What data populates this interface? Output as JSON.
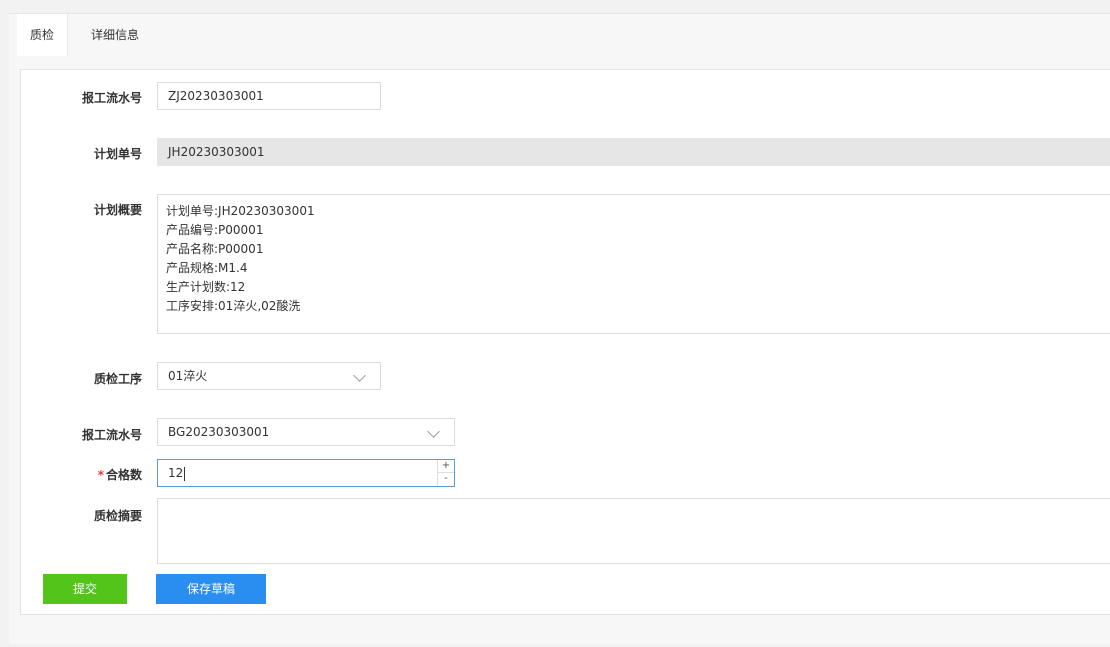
{
  "tabs": [
    {
      "label": "质检",
      "active": true
    },
    {
      "label": "详细信息",
      "active": false
    }
  ],
  "form": {
    "report_serial_label": "报工流水号",
    "report_serial_value": "ZJ20230303001",
    "plan_no_label": "计划单号",
    "plan_no_value": "JH20230303001",
    "plan_summary_label": "计划概要",
    "plan_summary_lines": [
      "计划单号:JH20230303001",
      "产品编号:P00001",
      "产品名称:P00001",
      "产品规格:M1.4",
      "生产计划数:12",
      "工序安排:01淬火,02酸洗"
    ],
    "qc_process_label": "质检工序",
    "qc_process_value": "01淬火",
    "work_report_label": "报工流水号",
    "work_report_value": "BG20230303001",
    "qualified_required_mark": "*",
    "qualified_label": "合格数",
    "qualified_value": "12",
    "stepper_up": "+",
    "stepper_down": "-",
    "qc_summary_label": "质检摘要",
    "qc_summary_value": ""
  },
  "buttons": {
    "submit": "提交",
    "save_draft": "保存草稿"
  },
  "colors": {
    "submit_bg": "#52c41a",
    "save_draft_bg": "#2a8ef0",
    "required": "#e23b3b",
    "focus_border": "#5b9bd5"
  }
}
